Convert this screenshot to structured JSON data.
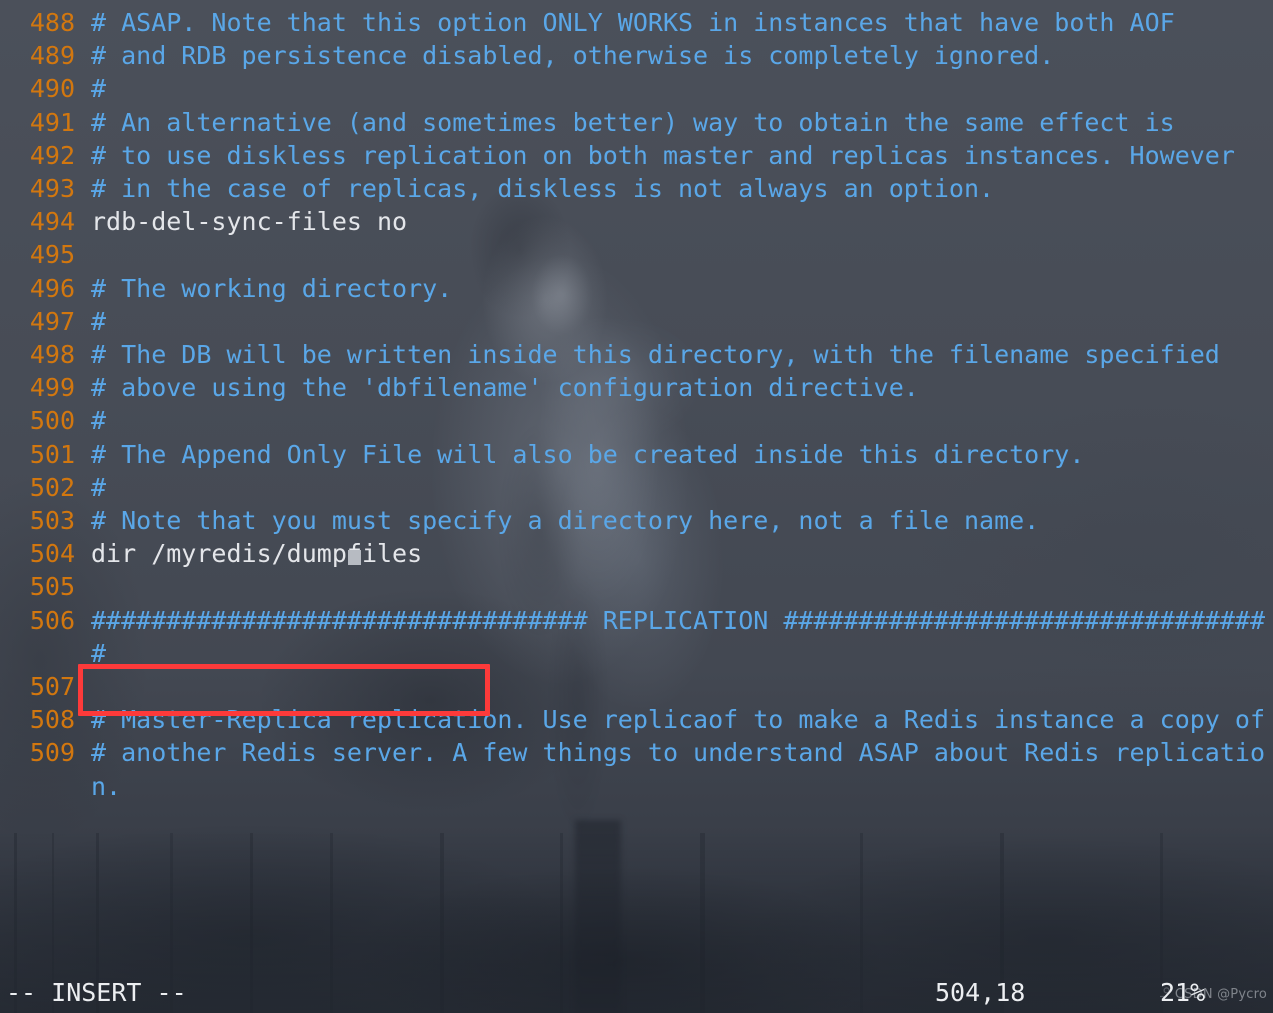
{
  "app": {
    "name": "vim",
    "file_type": "redis.conf"
  },
  "colors": {
    "background": "#474c56",
    "comment_blue": "#5aa7e8",
    "line_number_orange": "#d2770f",
    "code_white": "#e4e6ea",
    "annotation_red": "#fd3a3a",
    "status_text": "#eceef1",
    "cursor_block": "#b7bbc2"
  },
  "editor": {
    "lines": [
      {
        "number": "488",
        "text": "# ASAP. Note that this option ONLY WORKS in instances that have both AOF",
        "kind": "comment"
      },
      {
        "number": "489",
        "text": "# and RDB persistence disabled, otherwise is completely ignored.",
        "kind": "comment"
      },
      {
        "number": "490",
        "text": "#",
        "kind": "comment"
      },
      {
        "number": "491",
        "text": "# An alternative (and sometimes better) way to obtain the same effect is",
        "kind": "comment"
      },
      {
        "number": "492",
        "text": "# to use diskless replication on both master and replicas instances. However",
        "kind": "comment"
      },
      {
        "number": "493",
        "text": "# in the case of replicas, diskless is not always an option.",
        "kind": "comment"
      },
      {
        "number": "494",
        "text": "rdb-del-sync-files no",
        "kind": "code"
      },
      {
        "number": "495",
        "text": "",
        "kind": "empty"
      },
      {
        "number": "496",
        "text": "# The working directory.",
        "kind": "comment"
      },
      {
        "number": "497",
        "text": "#",
        "kind": "comment"
      },
      {
        "number": "498",
        "text": "# The DB will be written inside this directory, with the filename specified",
        "kind": "comment"
      },
      {
        "number": "499",
        "text": "# above using the 'dbfilename' configuration directive.",
        "kind": "comment"
      },
      {
        "number": "500",
        "text": "#",
        "kind": "comment"
      },
      {
        "number": "501",
        "text": "# The Append Only File will also be created inside this directory.",
        "kind": "comment"
      },
      {
        "number": "502",
        "text": "#",
        "kind": "comment"
      },
      {
        "number": "503",
        "text": "# Note that you must specify a directory here, not a file name.",
        "kind": "comment"
      },
      {
        "number": "504",
        "text": "dir /myredis/dumpfiles",
        "kind": "code",
        "cursor": true,
        "highlighted": true
      },
      {
        "number": "505",
        "text": "",
        "kind": "empty"
      },
      {
        "number": "506",
        "text": "################################# REPLICATION #################################",
        "kind": "comment"
      },
      {
        "number": "507",
        "text": "",
        "kind": "empty"
      },
      {
        "number": "508",
        "text": "# Master-Replica replication. Use replicaof to make a Redis instance a copy of",
        "kind": "comment"
      },
      {
        "number": "509",
        "text": "# another Redis server. A few things to understand ASAP about Redis replication.",
        "kind": "comment"
      }
    ]
  },
  "statusline": {
    "mode": "-- INSERT --",
    "ruler": "504,18",
    "percent": "21%"
  },
  "watermark": {
    "text": "CSDN @Pycro"
  }
}
